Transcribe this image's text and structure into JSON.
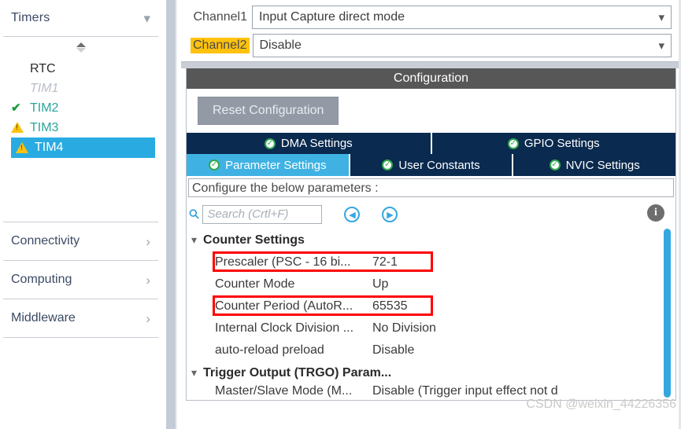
{
  "sidebar": {
    "header": {
      "label": "Timers",
      "chevron": "chevron-down-icon"
    },
    "spinner": "sort-spinner-icon",
    "timers": [
      {
        "label": "RTC",
        "state": "plain",
        "icon": ""
      },
      {
        "label": "TIM1",
        "state": "disabled",
        "icon": ""
      },
      {
        "label": "TIM2",
        "state": "ok",
        "icon": "check-icon"
      },
      {
        "label": "TIM3",
        "state": "warn",
        "icon": "warning-icon"
      },
      {
        "label": "TIM4",
        "state": "selected",
        "icon": "warning-icon"
      }
    ],
    "nav": [
      {
        "label": "Connectivity",
        "chevron": "chevron-right-icon"
      },
      {
        "label": "Computing",
        "chevron": "chevron-right-icon"
      },
      {
        "label": "Middleware",
        "chevron": "chevron-right-icon"
      }
    ],
    "colors": {
      "selection": "#29ABE2",
      "label": "#3b4a64",
      "ok": "#2aa59a",
      "warn_triangle": "#FFC20E"
    }
  },
  "channels": [
    {
      "label": "Channel1",
      "value": "Input Capture direct mode",
      "highlighted": false,
      "carat": "chevron-down-icon"
    },
    {
      "label": "Channel2",
      "value": "Disable",
      "highlighted": true,
      "carat": "chevron-down-icon"
    }
  ],
  "configuration": {
    "title": "Configuration",
    "reset_label": "Reset Configuration",
    "tabs_row1": [
      {
        "label": "DMA Settings",
        "active": false,
        "icon": "green-check-icon"
      },
      {
        "label": "GPIO Settings",
        "active": false,
        "icon": "green-check-icon"
      }
    ],
    "tabs_row2": [
      {
        "label": "Parameter Settings",
        "active": true,
        "icon": "green-check-icon"
      },
      {
        "label": "User Constants",
        "active": false,
        "icon": "green-check-icon"
      },
      {
        "label": "NVIC Settings",
        "active": false,
        "icon": "green-check-icon"
      }
    ],
    "configure_hint": "Configure the below parameters :",
    "colors": {
      "tab_inactive": "#0b2a4f",
      "tab_active": "#3fb2e3",
      "title_bar": "#575757",
      "highlight_yellow": "#FFC20E",
      "box_red": "#ff0000"
    }
  },
  "search": {
    "icon": "search-icon",
    "placeholder": "Search (Crtl+F)",
    "value": "",
    "prev_icon": "circle-left-arrow-icon",
    "next_icon": "circle-right-arrow-icon",
    "info_icon": "info-icon"
  },
  "parameters": {
    "groups": [
      {
        "name": "Counter Settings",
        "chevron": "chevron-down-icon",
        "rows": [
          {
            "name": "Prescaler (PSC - 16 bi...",
            "value": "72-1",
            "boxed": true
          },
          {
            "name": "Counter Mode",
            "value": "Up",
            "boxed": false
          },
          {
            "name": "Counter Period (AutoR...",
            "value": "65535",
            "boxed": true
          },
          {
            "name": "Internal Clock Division ...",
            "value": "No Division",
            "boxed": false
          },
          {
            "name": "auto-reload preload",
            "value": "Disable",
            "boxed": false
          }
        ]
      },
      {
        "name": "Trigger Output (TRGO) Param...",
        "chevron": "chevron-down-icon",
        "rows": [
          {
            "name": "Master/Slave Mode (M...",
            "value": "Disable (Trigger input effect not d",
            "boxed": false
          }
        ]
      }
    ]
  },
  "scrollbar": {
    "name": "vertical-scrollbar",
    "color": "#35a7e0"
  },
  "watermark": "CSDN @weixin_44226356"
}
